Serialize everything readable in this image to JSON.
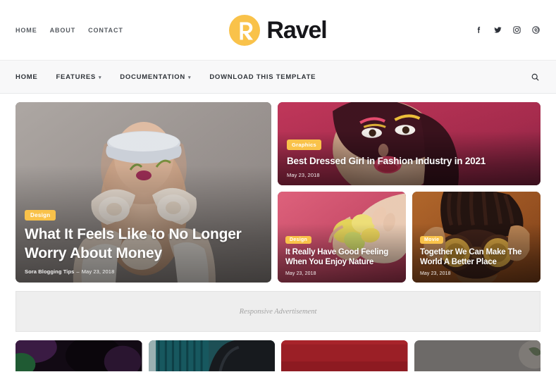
{
  "topbar": {
    "nav": [
      {
        "label": "HOME",
        "name": "top-nav-home"
      },
      {
        "label": "ABOUT",
        "name": "top-nav-about"
      },
      {
        "label": "CONTACT",
        "name": "top-nav-contact"
      }
    ],
    "brand_name": "Ravel",
    "logo_letter": "R",
    "social": [
      {
        "icon": "facebook-icon",
        "label": "Facebook"
      },
      {
        "icon": "twitter-icon",
        "label": "Twitter"
      },
      {
        "icon": "instagram-icon",
        "label": "Instagram"
      },
      {
        "icon": "pinterest-icon",
        "label": "Pinterest"
      }
    ]
  },
  "mainnav": {
    "items": [
      {
        "label": "HOME",
        "caret": false
      },
      {
        "label": "FEATURES",
        "caret": true
      },
      {
        "label": "DOCUMENTATION",
        "caret": true
      },
      {
        "label": "DOWNLOAD THIS TEMPLATE",
        "caret": false
      }
    ],
    "caret_glyph": "▾",
    "search_icon": "search-icon"
  },
  "posts": {
    "hero": {
      "category": "Design",
      "title": "What It Feels Like to No Longer Worry About Money",
      "author": "Sora Blogging Tips",
      "separator": "–",
      "date": "May 23, 2018"
    },
    "wide": {
      "category": "Graphics",
      "title": "Best Dressed Girl in Fashion Industry in 2021",
      "date": "May 23, 2018"
    },
    "small_left": {
      "category": "Design",
      "title": "It Really Have Good Feeling When You Enjoy Nature",
      "date": "May 23, 2018"
    },
    "small_right": {
      "category": "Movie",
      "title": "Together We Can Make The World A Better Place",
      "date": "May 23, 2018"
    }
  },
  "advertisement": {
    "label": "Responsive Advertisement"
  },
  "colors": {
    "brand_yellow": "#f9c24a",
    "badge_text": "#ffffff",
    "nav_background": "#f8f8f9",
    "page_background": "#ffffff",
    "ad_background": "#eeeeee"
  }
}
